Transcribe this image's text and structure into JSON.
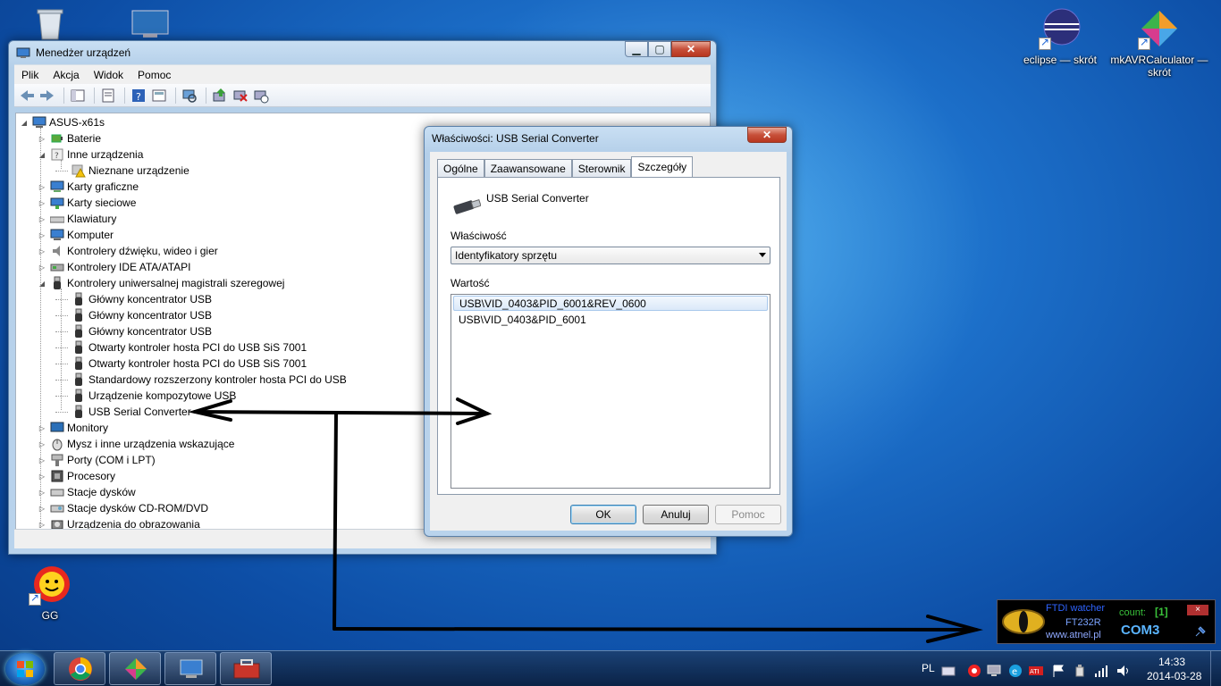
{
  "desktop": {
    "icons": [
      {
        "label": "eclipse — skrót"
      },
      {
        "label": "mkAVRCalculator — skrót"
      },
      {
        "label": "GG"
      }
    ]
  },
  "device_manager": {
    "title": "Menedżer urządzeń",
    "menu": [
      "Plik",
      "Akcja",
      "Widok",
      "Pomoc"
    ],
    "tree": {
      "root": "ASUS-x61s",
      "items": [
        "Baterie",
        "Inne urządzenia",
        "Nieznane urządzenie",
        "Karty graficzne",
        "Karty sieciowe",
        "Klawiatury",
        "Komputer",
        "Kontrolery dźwięku, wideo i gier",
        "Kontrolery IDE ATA/ATAPI",
        "Kontrolery uniwersalnej magistrali szeregowej",
        "Główny koncentrator USB",
        "Główny koncentrator USB",
        "Główny koncentrator USB",
        "Otwarty kontroler hosta PCI do USB SiS 7001",
        "Otwarty kontroler hosta PCI do USB SiS 7001",
        "Standardowy rozszerzony kontroler hosta PCI do USB",
        "Urządzenie kompozytowe USB",
        "USB Serial Converter",
        "Monitory",
        "Mysz i inne urządzenia wskazujące",
        "Porty (COM i LPT)",
        "Procesory",
        "Stacje dysków",
        "Stacje dysków CD-ROM/DVD",
        "Urządzenia do obrazowania"
      ]
    }
  },
  "properties": {
    "title": "Właściwości: USB Serial Converter",
    "tabs": [
      "Ogólne",
      "Zaawansowane",
      "Sterownik",
      "Szczegóły"
    ],
    "active_tab": "Szczegóły",
    "device_name": "USB Serial Converter",
    "property_label": "Właściwość",
    "property_value": "Identyfikatory sprzętu",
    "value_label": "Wartość",
    "values": [
      "USB\\VID_0403&PID_6001&REV_0600",
      "USB\\VID_0403&PID_6001"
    ],
    "buttons": {
      "ok": "OK",
      "cancel": "Anuluj",
      "help": "Pomoc"
    }
  },
  "ftdi_widget": {
    "title": "FTDI watcher",
    "chip": "FT232R",
    "site": "www.atnel.pl",
    "count_label": "count:",
    "count_value": "[1]",
    "port": "COM3",
    "close": "×"
  },
  "taskbar": {
    "language": "PL",
    "time": "14:33",
    "date": "2014-03-28"
  },
  "colors": {
    "desktop": "#1c6fc9",
    "ftdi_title": "#2f64ff",
    "ftdi_count": "#39c13a",
    "ftdi_port": "#5ab4ff"
  }
}
